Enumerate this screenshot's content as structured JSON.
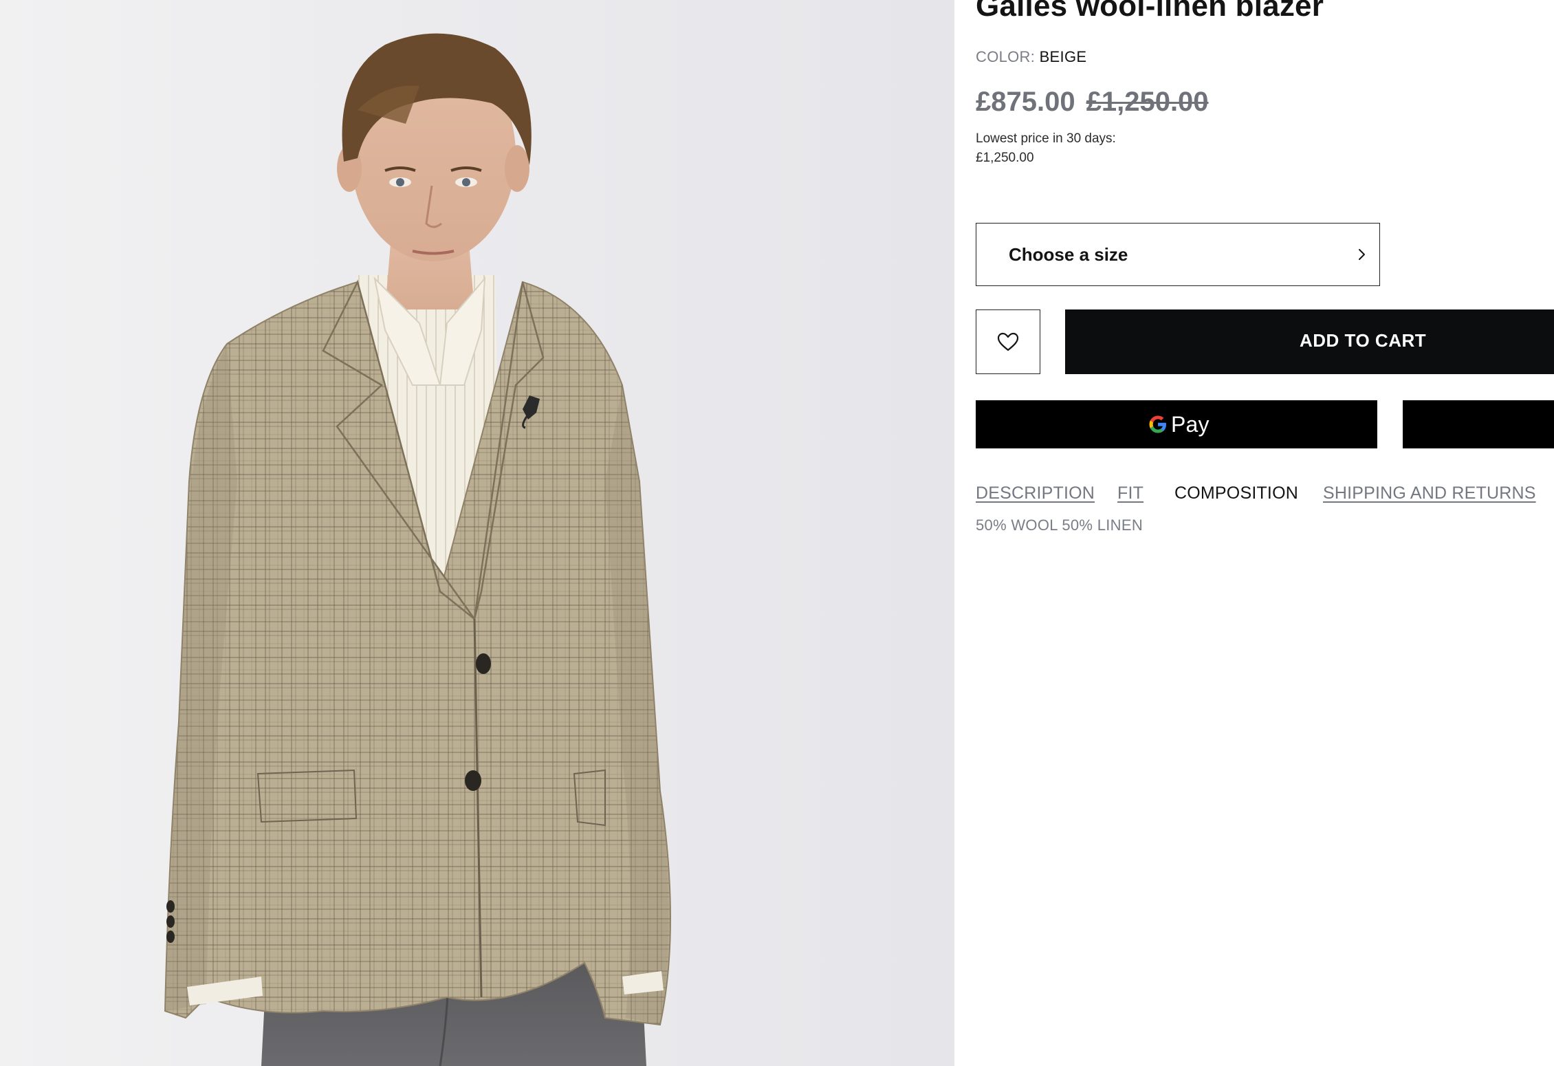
{
  "product": {
    "title": "Galles wool-linen blazer",
    "color_label": "COLOR:",
    "color_value": "BEIGE",
    "price_current": "£875.00",
    "price_original": "£1,250.00",
    "lowest_price_label": "Lowest price in 30 days:",
    "lowest_price_value": "£1,250.00"
  },
  "size_selector": {
    "label": "Choose a size",
    "icon": "chevron-right-icon"
  },
  "actions": {
    "wishlist_icon": "heart-icon",
    "add_to_cart_label": "ADD TO CART",
    "gpay_label": "Pay"
  },
  "tabs": [
    {
      "label": "DESCRIPTION",
      "active": false
    },
    {
      "label": "FIT",
      "active": false
    },
    {
      "label": "COMPOSITION",
      "active": true
    },
    {
      "label": "SHIPPING AND RETURNS",
      "active": false
    }
  ],
  "composition": {
    "text": "50% WOOL 50% LINEN"
  },
  "colors": {
    "accent_black": "#0c0d0f",
    "muted_text": "#7a7d85",
    "blazer_beige": "#b3a68b"
  }
}
